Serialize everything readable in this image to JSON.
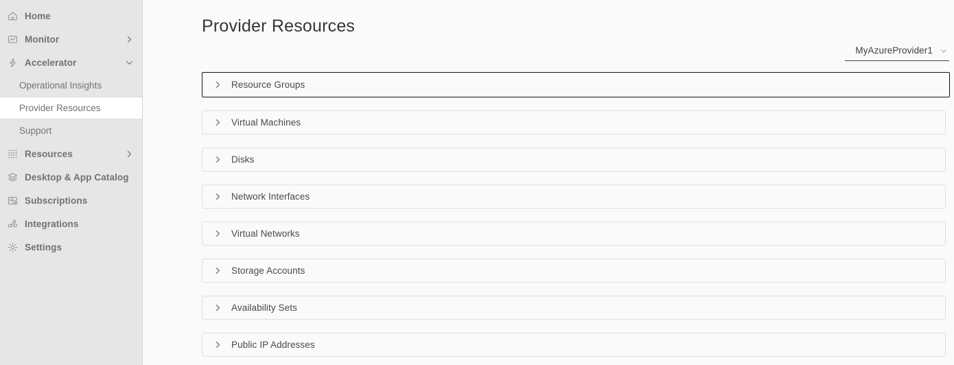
{
  "sidebar": {
    "items": [
      {
        "label": "Home",
        "icon": "home-icon",
        "type": "top",
        "caret": "none"
      },
      {
        "label": "Monitor",
        "icon": "monitor-chart-icon",
        "type": "top",
        "caret": "right"
      },
      {
        "label": "Accelerator",
        "icon": "lightning-bolt-icon",
        "type": "top",
        "caret": "down"
      },
      {
        "label": "Operational Insights",
        "icon": "",
        "type": "sub",
        "caret": "none",
        "active": false
      },
      {
        "label": "Provider Resources",
        "icon": "",
        "type": "sub",
        "caret": "none",
        "active": true
      },
      {
        "label": "Support",
        "icon": "",
        "type": "sub",
        "caret": "none",
        "active": false
      },
      {
        "label": "Resources",
        "icon": "grid-dots-icon",
        "type": "top",
        "caret": "right"
      },
      {
        "label": "Desktop & App Catalog",
        "icon": "layers-icon",
        "type": "top",
        "caret": "none"
      },
      {
        "label": "Subscriptions",
        "icon": "document-search-icon",
        "type": "top",
        "caret": "none"
      },
      {
        "label": "Integrations",
        "icon": "nodes-icon",
        "type": "top",
        "caret": "none"
      },
      {
        "label": "Settings",
        "icon": "gear-icon",
        "type": "top",
        "caret": "none"
      }
    ]
  },
  "header": {
    "title": "Provider Resources"
  },
  "provider_dropdown": {
    "selected": "MyAzureProvider1",
    "caret_icon": "chevron-down-icon"
  },
  "accordion": {
    "rows": [
      {
        "label": "Resource Groups",
        "caret_icon": "chevron-right-icon",
        "expanded": false,
        "focused": true
      },
      {
        "label": "Virtual Machines",
        "caret_icon": "chevron-right-icon",
        "expanded": false,
        "focused": false
      },
      {
        "label": "Disks",
        "caret_icon": "chevron-right-icon",
        "expanded": false,
        "focused": false
      },
      {
        "label": "Network Interfaces",
        "caret_icon": "chevron-right-icon",
        "expanded": false,
        "focused": false
      },
      {
        "label": "Virtual Networks",
        "caret_icon": "chevron-right-icon",
        "expanded": false,
        "focused": false
      },
      {
        "label": "Storage Accounts",
        "caret_icon": "chevron-right-icon",
        "expanded": false,
        "focused": false
      },
      {
        "label": "Availability Sets",
        "caret_icon": "chevron-right-icon",
        "expanded": false,
        "focused": false
      },
      {
        "label": "Public IP Addresses",
        "caret_icon": "chevron-right-icon",
        "expanded": false,
        "focused": false
      }
    ]
  },
  "colors": {
    "sidebar_bg": "#e6e6e6",
    "sidebar_active_bg": "#ffffff",
    "content_bg": "#fafafa",
    "row_border": "#dedede",
    "row_border_focused": "#111315",
    "title_text": "#33373b",
    "nav_text": "#6f7175",
    "row_text": "#46494d"
  }
}
